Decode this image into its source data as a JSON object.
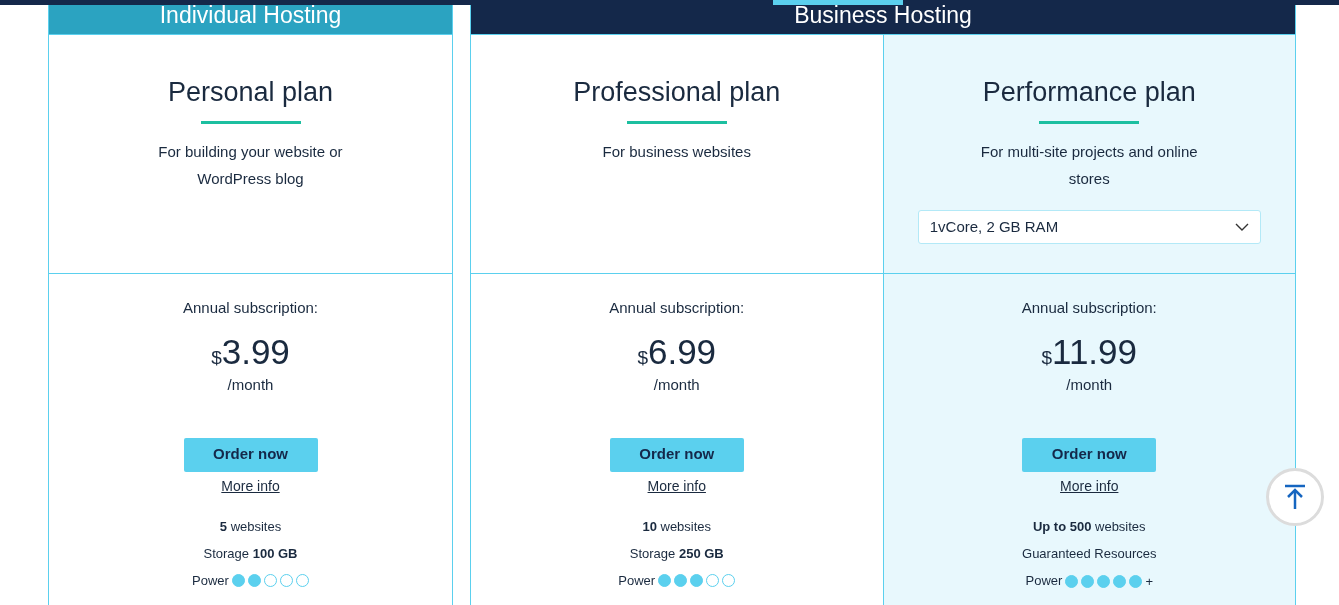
{
  "groups": [
    {
      "title": "Individual Hosting",
      "kind": "individual",
      "plans": [
        {
          "name": "Personal plan",
          "description": "For building your website or WordPress blog",
          "highlighted": false,
          "billing": "Annual subscription:",
          "currency": "$",
          "price": "3.99",
          "period": "/month",
          "order_button": "Order now",
          "more_info": "More info",
          "features": [
            "**5** websites",
            "Storage **100 GB**"
          ],
          "power_label": "Power",
          "stars": 2
        }
      ]
    },
    {
      "title": "Business Hosting",
      "kind": "business",
      "plans": [
        {
          "name": "Professional plan",
          "description": "For business websites",
          "highlighted": false,
          "billing": "Annual subscription:",
          "currency": "$",
          "price": "6.99",
          "period": "/month",
          "order_button": "Order now",
          "more_info": "More info",
          "features": [
            "**10** websites",
            "Storage **250 GB**"
          ],
          "power_label": "Power",
          "stars": 3
        },
        {
          "name": "Performance plan",
          "description": "For multi-site projects and online stores",
          "highlighted": true,
          "select": {
            "value": "1vCore, 2 GB RAM"
          },
          "billing": "Annual subscription:",
          "currency": "$",
          "price": "11.99",
          "period": "/month",
          "order_button": "Order now",
          "more_info": "More info",
          "features": [
            "**Up to 500** websites",
            "Guaranteed Resources"
          ],
          "power_label": "Power",
          "stars": 5,
          "power_suffix": "+"
        }
      ]
    }
  ]
}
